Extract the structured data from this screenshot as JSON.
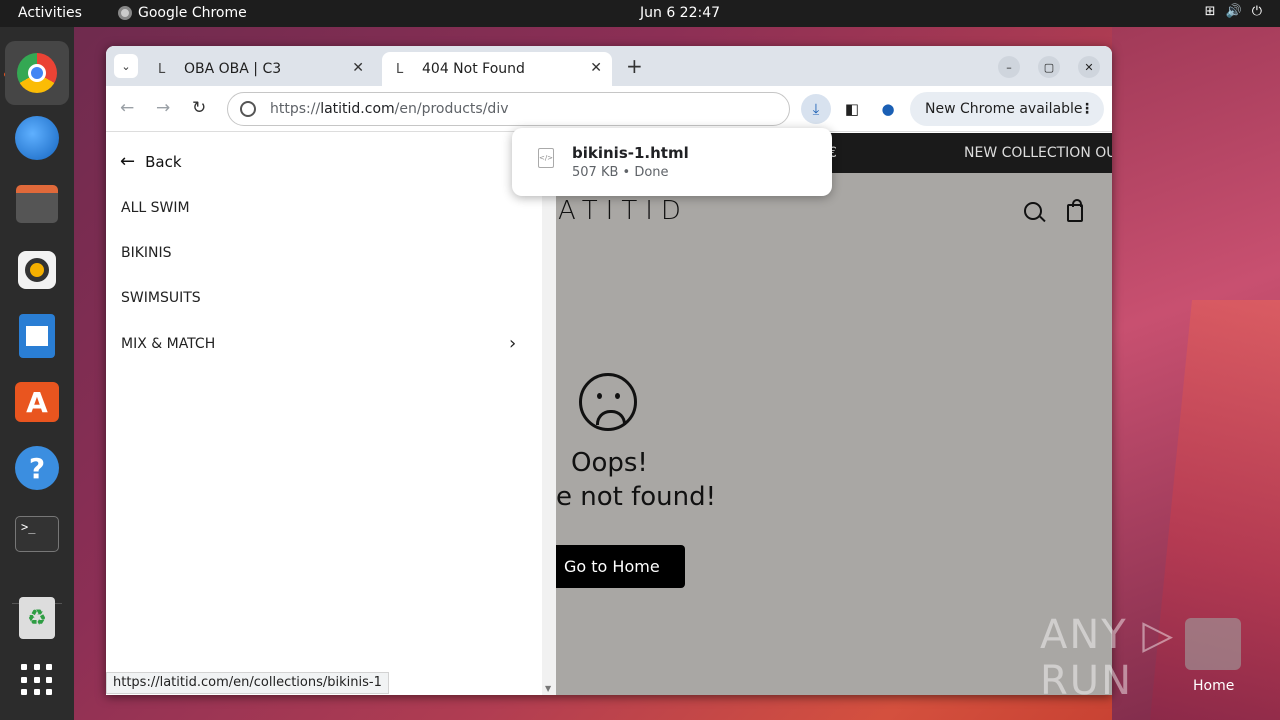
{
  "topbar": {
    "activities": "Activities",
    "app_name": "Google Chrome",
    "clock": "Jun 6  22:47",
    "tray_icons": [
      "network-icon",
      "volume-icon",
      "power-icon"
    ]
  },
  "dock": {
    "items": [
      "chrome",
      "thunderbird",
      "files",
      "rhythmbox",
      "libreoffice-writer",
      "app-center",
      "help",
      "terminal",
      "trash",
      "show-apps"
    ],
    "terminal_prompt": ">_"
  },
  "browser": {
    "tabs": [
      {
        "favicon": "L",
        "title": "OBA OBA | C3"
      },
      {
        "favicon": "L",
        "title": "404 Not Found"
      }
    ],
    "url_prefix": "https://",
    "url_domain": "latitid.com",
    "url_path": "/en/products/div",
    "update_label": "New Chrome available",
    "status_url": "https://latitid.com/en/collections/bikinis-1"
  },
  "download": {
    "file_name": "bikinis-1.html",
    "meta": "507 KB • Done",
    "file_icon": "</>"
  },
  "sidebar": {
    "back_label": "Back",
    "items": [
      "ALL SWIM",
      "BIKINIS",
      "SWIMSUITS",
      "MIX & MATCH"
    ]
  },
  "page": {
    "promo_1": "€",
    "promo_2": "NEW COLLECTION OU",
    "logo": "ATITID",
    "oops": "Oops!",
    "not_found": "e not found!",
    "home_button": "Go to Home"
  },
  "desktop": {
    "watermark": "ANY ▷ RUN",
    "home_label": "Home"
  }
}
